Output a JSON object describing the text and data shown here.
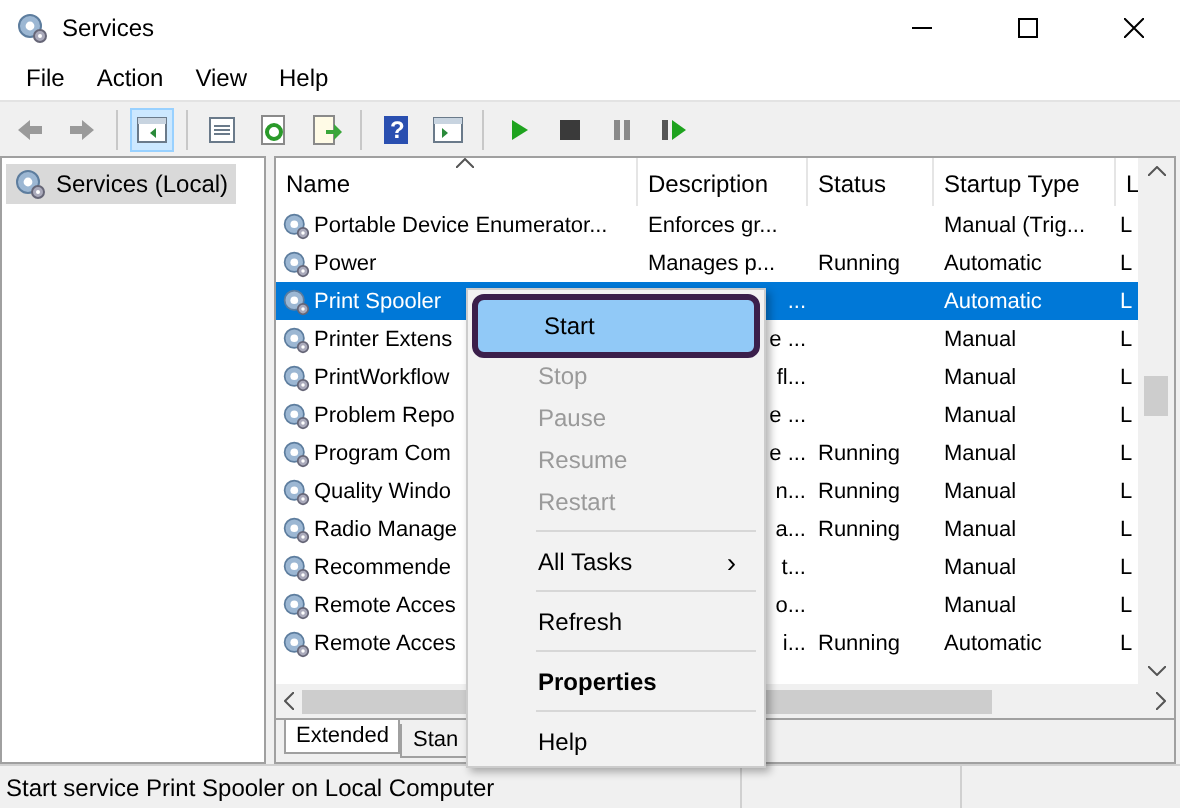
{
  "window": {
    "title": "Services"
  },
  "menu_bar": [
    "File",
    "Action",
    "View",
    "Help"
  ],
  "toolbar": [
    {
      "kind": "back"
    },
    {
      "kind": "forward"
    },
    {
      "kind": "sep"
    },
    {
      "kind": "pane",
      "selected": true
    },
    {
      "kind": "sep"
    },
    {
      "kind": "properties"
    },
    {
      "kind": "refresh"
    },
    {
      "kind": "export"
    },
    {
      "kind": "sep"
    },
    {
      "kind": "help",
      "glyph": "?"
    },
    {
      "kind": "actionpane"
    },
    {
      "kind": "sep"
    },
    {
      "kind": "start"
    },
    {
      "kind": "stop"
    },
    {
      "kind": "pause"
    },
    {
      "kind": "restart"
    }
  ],
  "tree": {
    "items": [
      {
        "label": "Services (Local)",
        "selected": true
      }
    ]
  },
  "table": {
    "columns": [
      "Name",
      "Description",
      "Status",
      "Startup Type",
      "L"
    ],
    "rows": [
      {
        "name": "Portable Device Enumerator...",
        "description": "Enforces gr...",
        "startup_type": "Manual (Trig...",
        "column_5": "L",
        "selected": false
      },
      {
        "name": "Power",
        "description": "Manages p...",
        "status": "Running",
        "startup_type": "Automatic",
        "column_5": "L",
        "selected": false
      },
      {
        "name": "Print Spooler",
        "description": "...",
        "startup_type": "Automatic",
        "column_5": "L",
        "selected": true
      },
      {
        "name": "Printer Extens",
        "description": "e ...",
        "startup_type": "Manual",
        "column_5": "L",
        "selected": false
      },
      {
        "name": "PrintWorkflow",
        "description": "fl...",
        "startup_type": "Manual",
        "column_5": "L",
        "selected": false
      },
      {
        "name": "Problem Repo",
        "description": "e ...",
        "startup_type": "Manual",
        "column_5": "L",
        "selected": false
      },
      {
        "name": "Program Com",
        "description": "e ...",
        "status": "Running",
        "startup_type": "Manual",
        "column_5": "L",
        "selected": false
      },
      {
        "name": "Quality Windo",
        "description": "n...",
        "status": "Running",
        "startup_type": "Manual",
        "column_5": "L",
        "selected": false
      },
      {
        "name": "Radio Manage",
        "description": "a...",
        "status": "Running",
        "startup_type": "Manual",
        "column_5": "L",
        "selected": false
      },
      {
        "name": "Recommende",
        "description": "t...",
        "startup_type": "Manual",
        "column_5": "L",
        "selected": false
      },
      {
        "name": "Remote Acces",
        "description": "o...",
        "startup_type": "Manual",
        "column_5": "L",
        "selected": false
      },
      {
        "name": "Remote Acces",
        "description": "i...",
        "status": "Running",
        "startup_type": "Automatic",
        "column_5": "L",
        "selected": false
      }
    ]
  },
  "tabs": [
    {
      "label": "Extended",
      "selected": true
    },
    {
      "label": "Stan",
      "selected": false
    }
  ],
  "context_menu": [
    {
      "kind": "item",
      "label": "Start",
      "disabled": false,
      "selected": true
    },
    {
      "kind": "item",
      "label": "Stop",
      "disabled": true,
      "selected": false
    },
    {
      "kind": "item",
      "label": "Pause",
      "disabled": true,
      "selected": false
    },
    {
      "kind": "item",
      "label": "Resume",
      "disabled": true,
      "selected": false
    },
    {
      "kind": "item",
      "label": "Restart",
      "disabled": true,
      "selected": false
    },
    {
      "kind": "sep"
    },
    {
      "kind": "submenu",
      "label": "All Tasks",
      "arrow": "›",
      "disabled": false,
      "selected": false
    },
    {
      "kind": "sep"
    },
    {
      "kind": "item",
      "label": "Refresh",
      "disabled": false,
      "selected": false
    },
    {
      "kind": "sep"
    },
    {
      "kind": "default",
      "label": "Properties",
      "disabled": false,
      "selected": false
    },
    {
      "kind": "sep"
    },
    {
      "kind": "item",
      "label": "Help",
      "disabled": false,
      "selected": false
    }
  ],
  "status_bar": "Start service Print Spooler on Local Computer"
}
